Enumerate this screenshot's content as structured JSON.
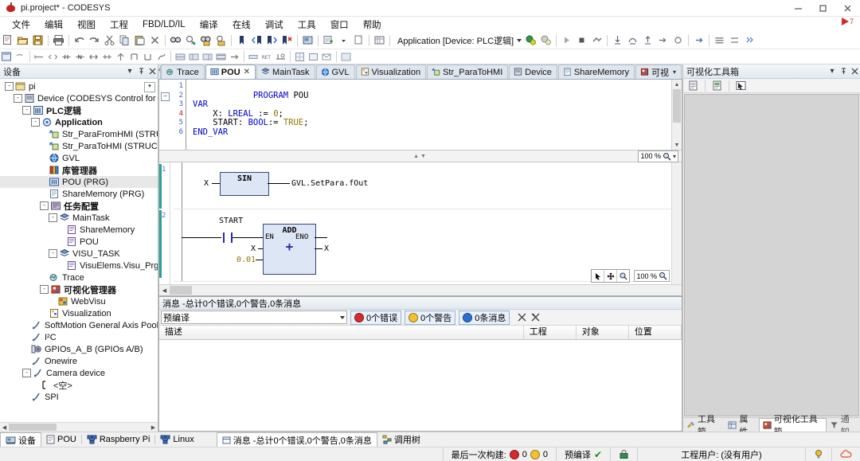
{
  "window": {
    "title": "pi.project* - CODESYS",
    "app_icon": "codesys-logo-icon",
    "minimize": "–",
    "maximize": "❐",
    "close": "✕"
  },
  "menubar": {
    "items": [
      {
        "label": "文件",
        "name": "menu-file"
      },
      {
        "label": "编辑",
        "name": "menu-edit"
      },
      {
        "label": "视图",
        "name": "menu-view"
      },
      {
        "label": "工程",
        "name": "menu-project"
      },
      {
        "label": "FBD/LD/IL",
        "name": "menu-fbdldil"
      },
      {
        "label": "编译",
        "name": "menu-build"
      },
      {
        "label": "在线",
        "name": "menu-online"
      },
      {
        "label": "调试",
        "name": "menu-debug"
      },
      {
        "label": "工具",
        "name": "menu-tools"
      },
      {
        "label": "窗口",
        "name": "menu-window"
      },
      {
        "label": "帮助",
        "name": "menu-help"
      }
    ],
    "flag_badge": "7"
  },
  "toolbar": {
    "application_selector": "Application [Device: PLC逻辑]",
    "buttons": [
      "new-icon",
      "open-icon",
      "save-icon",
      "print-icon",
      "undo-icon",
      "redo-icon",
      "cut-icon",
      "copy-icon",
      "paste-icon",
      "delete-icon",
      "find-icon",
      "find-next-icon",
      "replace-icon",
      "replace-next-icon",
      "bookmark-icon",
      "prev-bookmark-icon",
      "next-bookmark-icon",
      "clear-bookmark-icon",
      "device-icon",
      "add-object-icon",
      "add-folder-icon",
      "properties-icon"
    ],
    "online_buttons": [
      "login-icon",
      "logout-icon",
      "start-icon",
      "stop-icon",
      "reset-icon",
      "step-into-icon",
      "step-over-icon",
      "step-out-icon",
      "run-to-cursor-icon",
      "set-next-icon",
      "toggle-bp-icon",
      "flow-icon",
      "single-cycle-icon",
      "write-values-icon",
      "force-values-icon"
    ],
    "fbd_buttons": [
      "insert-network-icon",
      "insert-network-below-icon",
      "insert-assign-icon",
      "insert-box-icon",
      "insert-contact-icon",
      "insert-coil-icon",
      "insert-branch-icon",
      "insert-jump-icon",
      "insert-return-icon",
      "negate-icon",
      "set-reset-icon",
      "move-up-icon",
      "move-down-icon",
      "toggle-comment-icon",
      "zoom-icon",
      "grid-icon"
    ]
  },
  "device_panel": {
    "title": "设备",
    "header_buttons": [
      "dropdown-icon",
      "pin-icon",
      "close-icon"
    ],
    "tree": [
      {
        "label": "pi",
        "indent": 0,
        "icon": "project-icon",
        "expander": "-",
        "bold": false,
        "selected": false,
        "dropdown": true
      },
      {
        "label": "Device (CODESYS Control for Raspberry Pi SL",
        "indent": 1,
        "icon": "device-icon",
        "expander": "-",
        "bold": false,
        "selected": false
      },
      {
        "label": "PLC逻辑",
        "indent": 2,
        "icon": "plclogic-icon",
        "expander": "-",
        "bold": true,
        "selected": false
      },
      {
        "label": "Application",
        "indent": 3,
        "icon": "application-icon",
        "expander": "-",
        "bold": true,
        "selected": false
      },
      {
        "label": "Str_ParaFromHMI (STRUCT)",
        "indent": 4,
        "icon": "struct-icon",
        "expander": "",
        "bold": false,
        "selected": false
      },
      {
        "label": "Str_ParaToHMI (STRUCT)",
        "indent": 4,
        "icon": "struct-icon",
        "expander": "",
        "bold": false,
        "selected": false
      },
      {
        "label": "GVL",
        "indent": 4,
        "icon": "gvl-icon",
        "expander": "",
        "bold": false,
        "selected": false
      },
      {
        "label": "库管理器",
        "indent": 4,
        "icon": "library-icon",
        "expander": "",
        "bold": true,
        "selected": false
      },
      {
        "label": "POU (PRG)",
        "indent": 4,
        "icon": "pou-icon",
        "expander": "",
        "bold": false,
        "selected": true
      },
      {
        "label": "ShareMemory (PRG)",
        "indent": 4,
        "icon": "prg-icon",
        "expander": "",
        "bold": false,
        "selected": false
      },
      {
        "label": "任务配置",
        "indent": 4,
        "icon": "taskconfig-icon",
        "expander": "-",
        "bold": true,
        "selected": false
      },
      {
        "label": "MainTask",
        "indent": 5,
        "icon": "task-icon",
        "expander": "-",
        "bold": false,
        "selected": false
      },
      {
        "label": "ShareMemory",
        "indent": 6,
        "icon": "taskpou-icon",
        "expander": "",
        "bold": false,
        "selected": false
      },
      {
        "label": "POU",
        "indent": 6,
        "icon": "taskpou-icon",
        "expander": "",
        "bold": false,
        "selected": false
      },
      {
        "label": "VISU_TASK",
        "indent": 5,
        "icon": "task-icon",
        "expander": "-",
        "bold": false,
        "selected": false
      },
      {
        "label": "VisuElems.Visu_Prg",
        "indent": 6,
        "icon": "taskpou-icon",
        "expander": "",
        "bold": false,
        "selected": false
      },
      {
        "label": "Trace",
        "indent": 4,
        "icon": "trace-icon",
        "expander": "",
        "bold": false,
        "selected": false
      },
      {
        "label": "可视化管理器",
        "indent": 4,
        "icon": "visumanager-icon",
        "expander": "-",
        "bold": true,
        "selected": false
      },
      {
        "label": "WebVisu",
        "indent": 5,
        "icon": "webvisu-icon",
        "expander": "",
        "bold": false,
        "selected": false
      },
      {
        "label": "Visualization",
        "indent": 4,
        "icon": "visualization-icon",
        "expander": "",
        "bold": false,
        "selected": false
      },
      {
        "label": "SoftMotion General Axis Pool",
        "indent": 2,
        "icon": "plug-icon",
        "expander": "",
        "bold": false,
        "selected": false
      },
      {
        "label": "I²C",
        "indent": 2,
        "icon": "plug-icon",
        "expander": "",
        "bold": false,
        "selected": false
      },
      {
        "label": "GPIOs_A_B (GPIOs A/B)",
        "indent": 2,
        "icon": "gpio-icon",
        "expander": "",
        "bold": false,
        "selected": false
      },
      {
        "label": "Onewire",
        "indent": 2,
        "icon": "plug-icon",
        "expander": "",
        "bold": false,
        "selected": false
      },
      {
        "label": "Camera device",
        "indent": 2,
        "icon": "plug-icon",
        "expander": "-",
        "bold": false,
        "selected": false
      },
      {
        "label": "<空>",
        "indent": 3,
        "icon": "empty-slot-icon",
        "expander": "",
        "bold": false,
        "selected": false
      },
      {
        "label": "SPI",
        "indent": 2,
        "icon": "plug-icon",
        "expander": "",
        "bold": false,
        "selected": false
      }
    ]
  },
  "editor_tabs": [
    {
      "label": "Trace",
      "icon": "trace-icon",
      "active": false,
      "closable": false
    },
    {
      "label": "POU",
      "icon": "pou-icon",
      "active": true,
      "closable": true,
      "close": "✕"
    },
    {
      "label": "MainTask",
      "icon": "task-icon",
      "active": false,
      "closable": false
    },
    {
      "label": "GVL",
      "icon": "gvl-icon",
      "active": false,
      "closable": false
    },
    {
      "label": "Visualization",
      "icon": "visualization-icon",
      "active": false,
      "closable": false
    },
    {
      "label": "Str_ParaToHMI",
      "icon": "struct-icon",
      "active": false,
      "closable": false
    },
    {
      "label": "Device",
      "icon": "device-icon",
      "active": false,
      "closable": false
    },
    {
      "label": "ShareMemory",
      "icon": "prg-icon",
      "active": false,
      "closable": false
    },
    {
      "label": "可视",
      "icon": "visumanager-icon",
      "active": false,
      "closable": false,
      "dropdown": true
    }
  ],
  "declaration": {
    "line_numbers": [
      "1",
      "2",
      "3",
      "4",
      "5",
      "6"
    ],
    "lines": [
      "PROGRAM POU",
      "VAR",
      "    X: LREAL := 0;",
      "    START: BOOL:= TRUE;",
      "END_VAR",
      ""
    ],
    "zoom": "100 %",
    "zoom_icon": "magnifier-icon"
  },
  "fbd": {
    "zoom": "100 %",
    "zoom_icon": "magnifier-icon",
    "tools": [
      "pointer-icon",
      "pan-icon",
      "magnifier-icon"
    ],
    "networks": [
      {
        "number": "1",
        "block": {
          "name": "SIN",
          "symbol": ""
        },
        "input": "X",
        "output": "GVL.SetPara.fOut"
      },
      {
        "number": "2",
        "block": {
          "name": "ADD",
          "symbol": "+"
        },
        "contact": "START",
        "en_label": "EN",
        "eno_label": "ENO",
        "inputs": [
          "X",
          "0.01"
        ],
        "output": "X"
      }
    ]
  },
  "messages": {
    "header": "消息 -总计0个错误,0个警告,0条消息",
    "filter_value": "预编译",
    "chips": [
      {
        "label": "0个错误",
        "color": "#d42b2b",
        "icon": "error-icon"
      },
      {
        "label": "0个警告",
        "color": "#f2c12e",
        "icon": "warning-icon"
      },
      {
        "label": "0条消息",
        "color": "#2b6fd4",
        "icon": "info-icon"
      }
    ],
    "actions": [
      "clear-icon",
      "clear-all-icon"
    ],
    "columns": [
      "描述",
      "工程",
      "对象",
      "位置"
    ],
    "rows": []
  },
  "visu_toolbox": {
    "title": "可视化工具箱",
    "header_buttons": [
      "dropdown-icon",
      "pin-icon",
      "close-icon"
    ],
    "toolbar_buttons": [
      "list-icon",
      "list-green-icon",
      "pointer-arrow-icon"
    ],
    "tabs": [
      {
        "label": "工具箱",
        "icon": "toolbox-icon",
        "active": false
      },
      {
        "label": "属性",
        "icon": "properties-icon",
        "active": false
      },
      {
        "label": "可视化工具箱",
        "icon": "visutoolbox-icon",
        "active": true
      },
      {
        "label": "通知",
        "icon": "funnel-icon",
        "active": false
      }
    ]
  },
  "bottom_tabs": {
    "left": [
      {
        "label": "设备",
        "icon": "devices-icon",
        "active": true
      },
      {
        "label": "POU",
        "icon": "pou-icon",
        "active": false
      },
      {
        "label": "Raspberry Pi",
        "icon": "network-icon",
        "active": false
      },
      {
        "label": "Linux",
        "icon": "network-icon",
        "active": false
      }
    ],
    "right": [
      {
        "label": "消息 -总计0个错误,0个警告,0条消息",
        "icon": "messages-icon",
        "active": true
      },
      {
        "label": "调用树",
        "icon": "calltree-icon",
        "active": false
      }
    ]
  },
  "statusbar": {
    "last_build_label": "最后一次构建:",
    "last_build_errors": "0",
    "last_build_warnings": "0",
    "precompile_label": "预编译",
    "precompile_state": "✔",
    "project_user_label": "工程用户: (没有用户)",
    "icons": [
      "lock-closed-icon",
      "bulb-icon",
      "cloud-icon"
    ]
  }
}
